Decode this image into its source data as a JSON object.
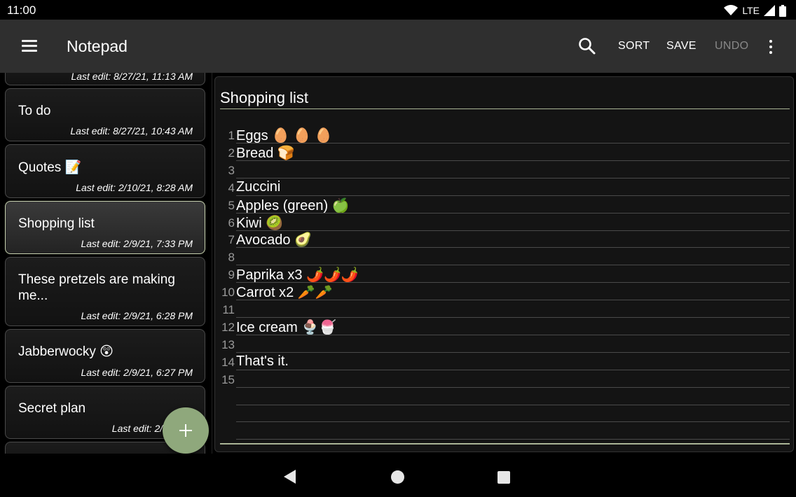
{
  "status_bar": {
    "time": "11:00",
    "network": "LTE"
  },
  "app_bar": {
    "title": "Notepad",
    "sort_label": "SORT",
    "save_label": "SAVE",
    "undo_label": "UNDO"
  },
  "notes": [
    {
      "title": "",
      "date": "Last edit: 8/27/21, 11:13 AM"
    },
    {
      "title": "To do",
      "date": "Last edit: 8/27/21, 10:43 AM"
    },
    {
      "title": "Quotes 📝",
      "date": "Last edit: 2/10/21, 8:28 AM"
    },
    {
      "title": "Shopping list",
      "date": "Last edit: 2/9/21, 7:33 PM"
    },
    {
      "title": "These pretzels are making me...",
      "date": "Last edit: 2/9/21, 6:28 PM"
    },
    {
      "title": "Jabberwocky 😲",
      "date": "Last edit: 2/9/21, 6:27 PM"
    },
    {
      "title": "Secret plan",
      "date": "Last edit: 2/9/21, 6"
    }
  ],
  "editor": {
    "title": "Shopping list",
    "lines": [
      {
        "num": "1",
        "text": "Eggs 🥚 🥚 🥚"
      },
      {
        "num": "2",
        "text": "Bread 🍞"
      },
      {
        "num": "3",
        "text": ""
      },
      {
        "num": "4",
        "text": "Zuccini"
      },
      {
        "num": "5",
        "text": "Apples (green) 🍏"
      },
      {
        "num": "6",
        "text": "Kiwi 🥝"
      },
      {
        "num": "7",
        "text": "Avocado 🥑"
      },
      {
        "num": "8",
        "text": ""
      },
      {
        "num": "9",
        "text": "Paprika x3 🌶️🌶️🌶️"
      },
      {
        "num": "10",
        "text": "Carrot x2 🥕🥕"
      },
      {
        "num": "11",
        "text": ""
      },
      {
        "num": "12",
        "text": "Ice cream 🍨🍧"
      },
      {
        "num": "13",
        "text": ""
      },
      {
        "num": "14",
        "text": "That's it."
      },
      {
        "num": "15",
        "text": ""
      },
      {
        "num": "",
        "text": ""
      },
      {
        "num": "",
        "text": ""
      },
      {
        "num": "",
        "text": ""
      }
    ]
  },
  "colors": {
    "accent": "#8fa87c",
    "underline": "#aab596",
    "app_bar": "#2f2f2f"
  }
}
